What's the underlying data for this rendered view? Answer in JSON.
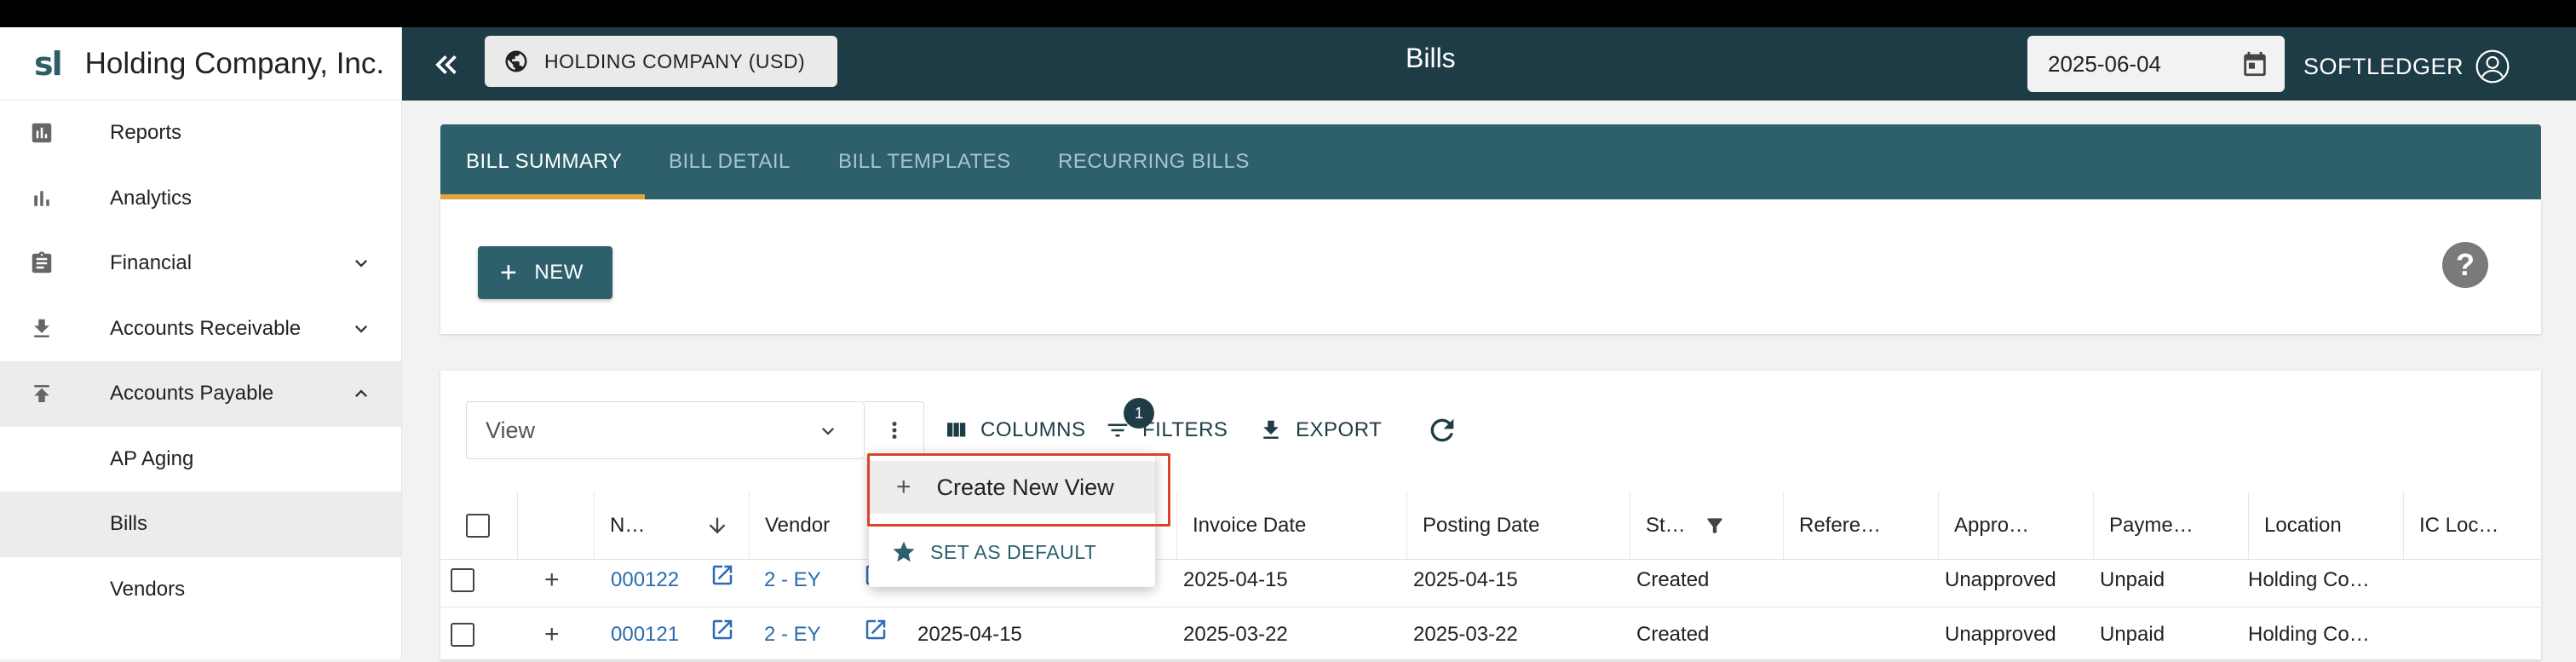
{
  "app": {
    "logo": "sl",
    "company": "Holding Company, Inc."
  },
  "sidebar": {
    "items": [
      {
        "label": "Reports",
        "icon": "reports-icon"
      },
      {
        "label": "Analytics",
        "icon": "bar-chart-icon"
      },
      {
        "label": "Financial",
        "icon": "clipboard-icon"
      },
      {
        "label": "Accounts Receivable",
        "icon": "download-icon"
      },
      {
        "label": "Accounts Payable",
        "icon": "upload-icon"
      },
      {
        "label": "AP Aging"
      },
      {
        "label": "Bills"
      },
      {
        "label": "Vendors"
      }
    ]
  },
  "header": {
    "entity": "HOLDING COMPANY (USD)",
    "title": "Bills",
    "date": "2025-06-04",
    "user": "SOFTLEDGER"
  },
  "tabs": [
    "BILL SUMMARY",
    "BILL DETAIL",
    "BILL TEMPLATES",
    "RECURRING BILLS"
  ],
  "actions": {
    "new_label": "NEW",
    "help": "?"
  },
  "toolbar": {
    "view_placeholder": "View",
    "columns_label": "COLUMNS",
    "filters_label": "FILTERS",
    "filters_count": "1",
    "export_label": "EXPORT"
  },
  "menu": {
    "create_view": "Create New View",
    "set_default": "SET AS DEFAULT"
  },
  "table": {
    "headers": [
      "N…",
      "Vendor",
      "Invoice Date",
      "Posting Date",
      "St…",
      "Refere…",
      "Appro…",
      "Payme…",
      "Location",
      "IC Loc…"
    ],
    "rows": [
      {
        "number": "000122",
        "vendor": "2 - EY",
        "due": "",
        "invoice_date": "2025-04-15",
        "posting_date": "2025-04-15",
        "status": "Created",
        "approval": "Unapproved",
        "payment": "Unpaid",
        "location": "Holding Co…"
      },
      {
        "number": "000121",
        "vendor": "2 - EY",
        "due": "2025-04-15",
        "invoice_date": "2025-03-22",
        "posting_date": "2025-03-22",
        "status": "Created",
        "approval": "Unapproved",
        "payment": "Unpaid",
        "location": "Holding Co…"
      }
    ]
  },
  "colors": {
    "header": "#1e3c46",
    "tabs": "#2e606b",
    "accent": "#e3a53b",
    "link": "#2a6cb0",
    "highlight": "#d9442a"
  }
}
